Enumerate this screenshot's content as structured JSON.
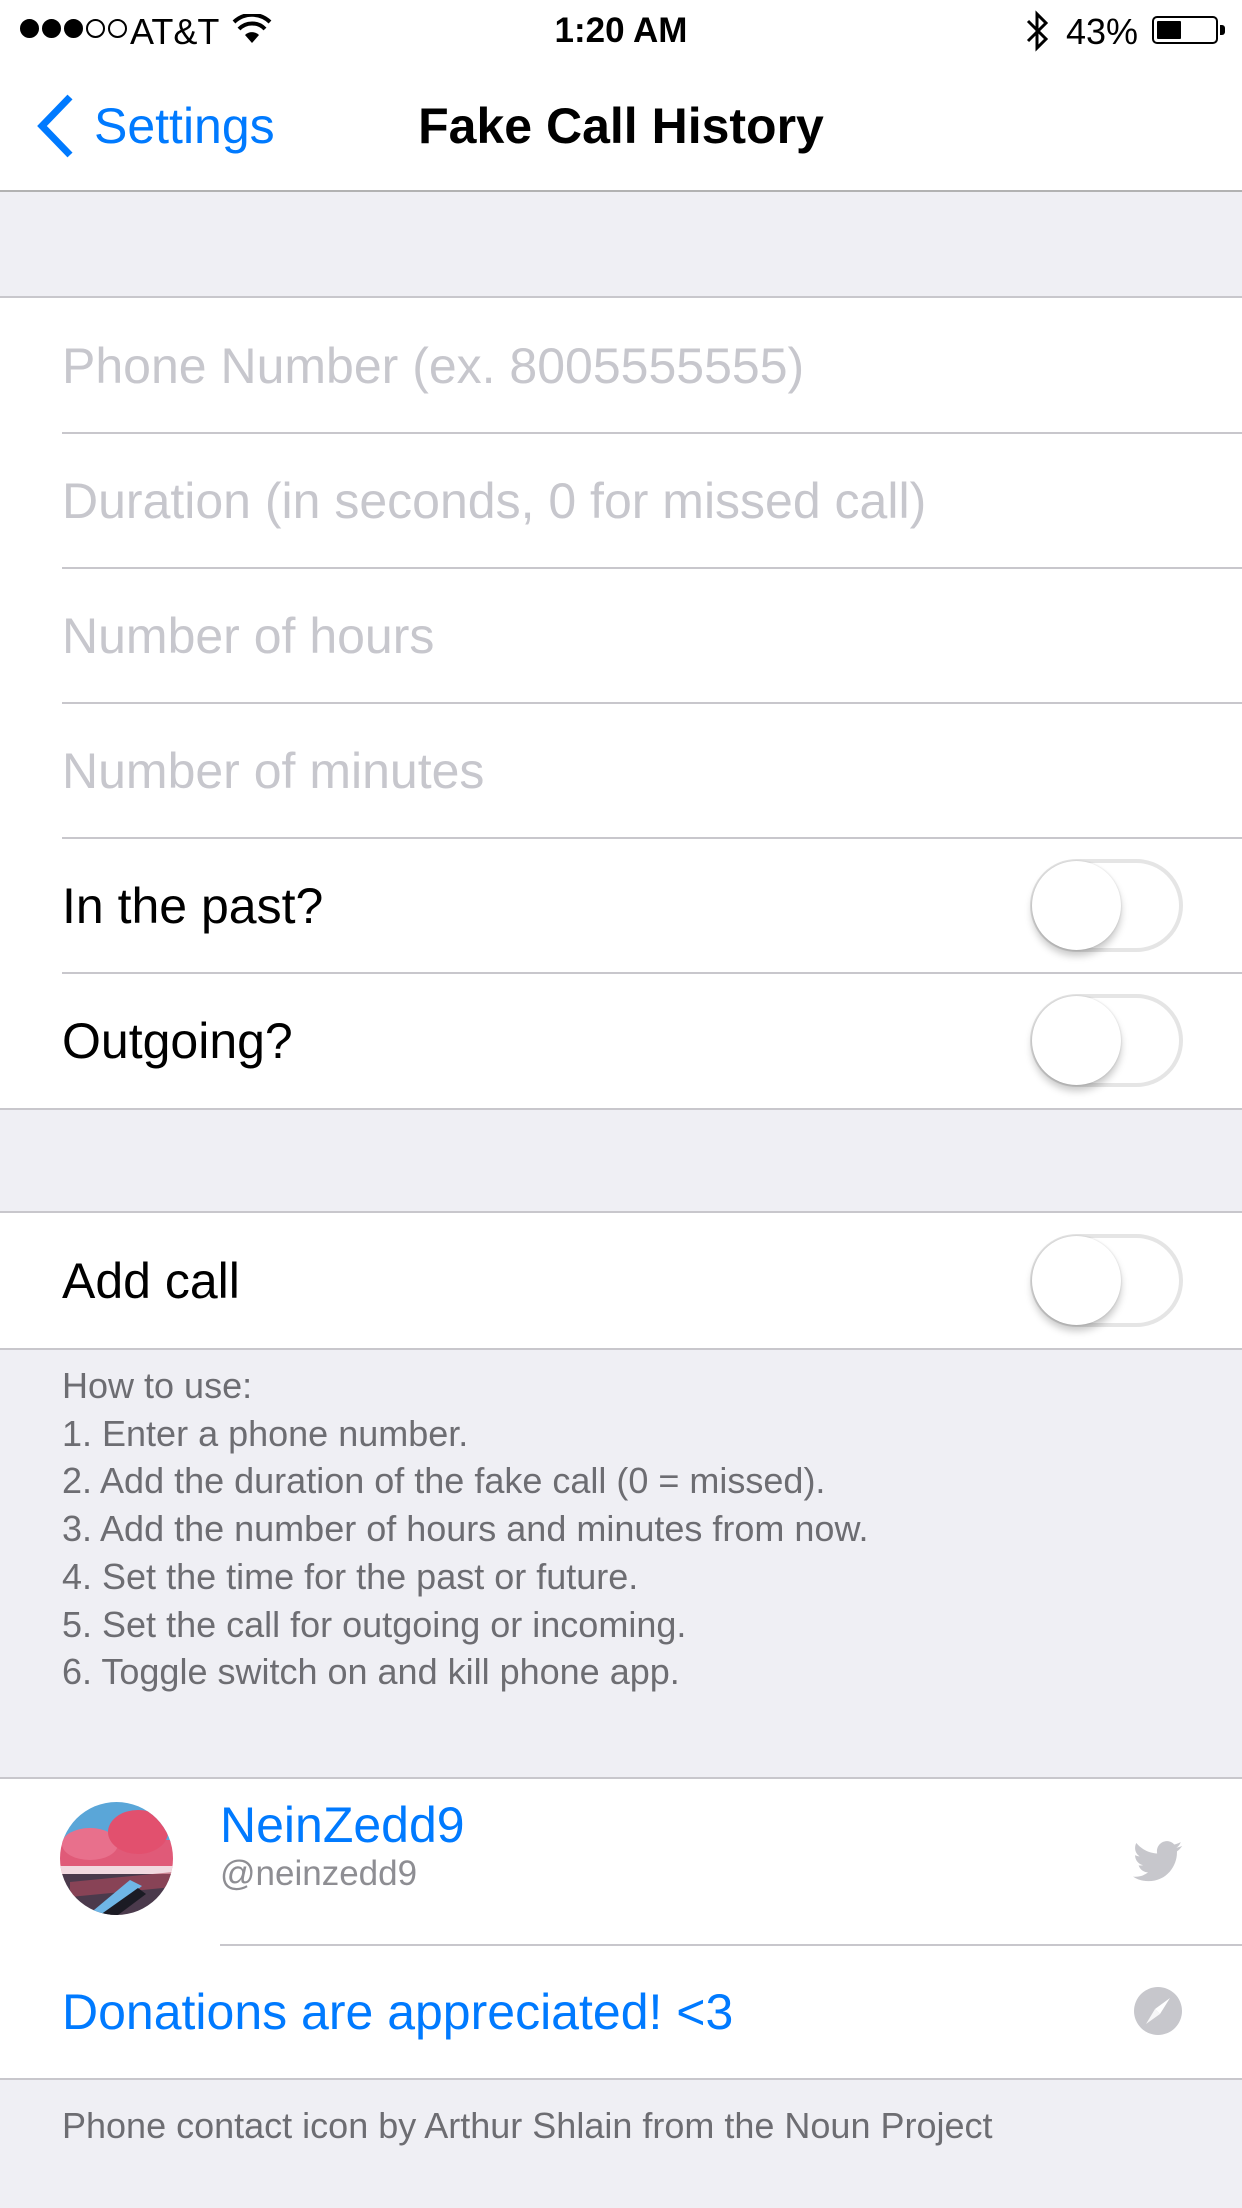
{
  "status_bar": {
    "signal_bars_filled": 3,
    "signal_bars_total": 5,
    "carrier": "AT&T",
    "time": "1:20 AM",
    "battery_percent_label": "43%",
    "battery_level": 0.43,
    "icons": [
      "signal-dots-icon",
      "wifi-icon",
      "bluetooth-icon",
      "battery-icon"
    ]
  },
  "nav": {
    "back_label": "Settings",
    "title": "Fake Call History"
  },
  "form": {
    "fields": [
      {
        "name": "phone-number",
        "value": "",
        "placeholder": "Phone Number (ex. 8005555555)"
      },
      {
        "name": "duration",
        "value": "",
        "placeholder": "Duration (in seconds, 0 for missed call)"
      },
      {
        "name": "hours",
        "value": "",
        "placeholder": "Number of hours"
      },
      {
        "name": "minutes",
        "value": "",
        "placeholder": "Number of minutes"
      }
    ],
    "toggles": [
      {
        "label": "In the past?",
        "on": false
      },
      {
        "label": "Outgoing?",
        "on": false
      }
    ]
  },
  "add_call": {
    "label": "Add call",
    "on": false
  },
  "instructions": {
    "lines": [
      "How to use:",
      "1. Enter a phone number.",
      "2. Add the duration of the fake call (0 = missed).",
      "3. Add the number of hours and minutes from now.",
      "4. Set the time for the past or future.",
      "5. Set the call for outgoing or incoming.",
      "6. Toggle switch on and kill phone app."
    ]
  },
  "profile": {
    "name": "NeinZedd9",
    "handle": "@neinzedd9",
    "icon": "twitter-icon"
  },
  "donations": {
    "label": "Donations are appreciated! <3",
    "icon": "safari-compass-icon"
  },
  "credit": "Phone contact icon by Arthur Shlain from the Noun Project",
  "colors": {
    "accent": "#007aff",
    "background": "#efeff4",
    "separator": "#c8c7cc",
    "placeholder": "#c7c7cd",
    "footer_text": "#6d6d72",
    "secondary_text": "#8e8e93",
    "icon_gray": "#c7c7cc"
  }
}
